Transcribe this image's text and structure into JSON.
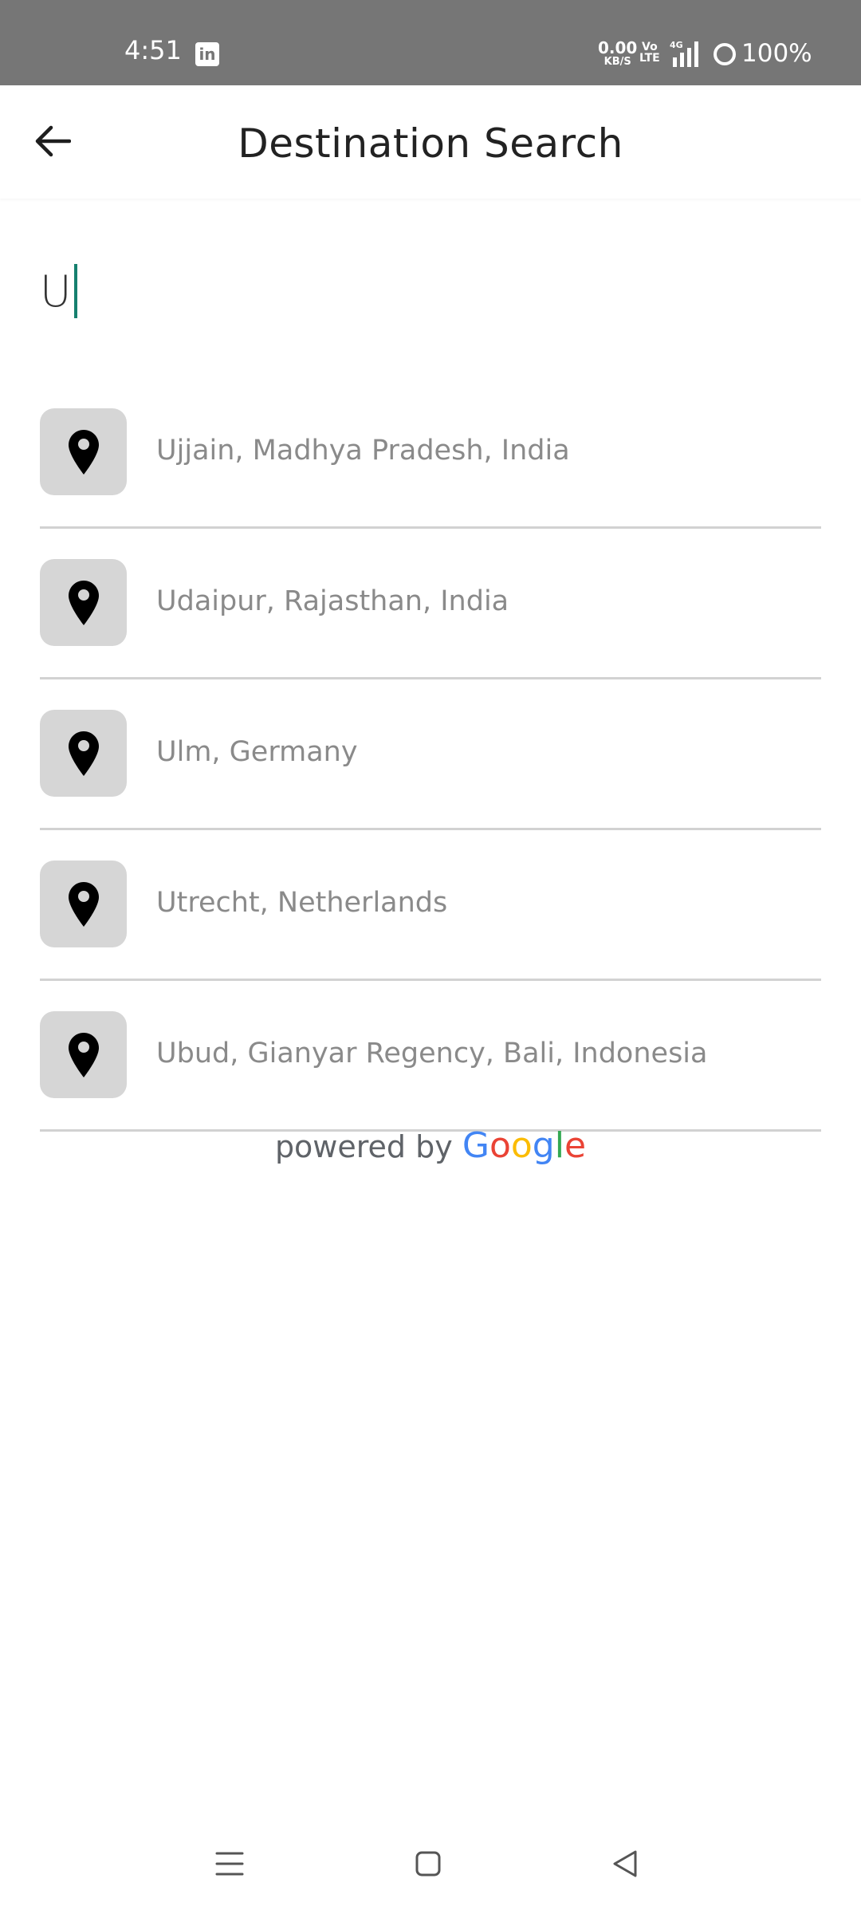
{
  "status_bar": {
    "time": "4:51",
    "linkedin_glyph": "in",
    "speed_value": "0.00",
    "speed_unit": "KB/S",
    "volte_line1": "Vo",
    "volte_line2": "LTE",
    "network": "4G",
    "battery": "100%"
  },
  "header": {
    "title": "Destination Search",
    "back_icon": "arrow-left-icon"
  },
  "search": {
    "value": "U",
    "caret_color": "#16806f"
  },
  "results": [
    {
      "label": "Ujjain, Madhya Pradesh, India",
      "icon": "map-pin-icon"
    },
    {
      "label": "Udaipur, Rajasthan, India",
      "icon": "map-pin-icon"
    },
    {
      "label": "Ulm, Germany",
      "icon": "map-pin-icon"
    },
    {
      "label": "Utrecht, Netherlands",
      "icon": "map-pin-icon"
    },
    {
      "label": "Ubud, Gianyar Regency, Bali, Indonesia",
      "icon": "map-pin-icon"
    }
  ],
  "attribution": {
    "prefix": "powered by",
    "logo_letters": [
      "G",
      "o",
      "o",
      "g",
      "l",
      "e"
    ],
    "logo_colors": [
      "#4285f4",
      "#ea4335",
      "#fbbc05",
      "#4285f4",
      "#34a853",
      "#ea4335"
    ]
  },
  "nav_bar": {
    "menu_icon": "menu-icon",
    "home_icon": "home-square-icon",
    "back_icon": "back-triangle-icon"
  }
}
